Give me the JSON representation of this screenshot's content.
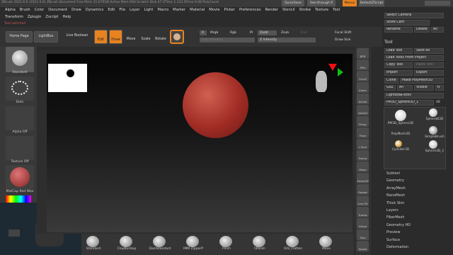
{
  "title": "ZBrush 2021.6.6 (2021.6.6) ZBrush Document",
  "title_stats": "Free Mem 31.679GB  Active Mem 694  Scratch Disk 47  ZTime 1.123 ATime 0.08  PolyCount",
  "quicksave": "QuickSave",
  "seethrough": "See-through 0",
  "menus_btn": "Menus",
  "defaultzscript": "DefaultZScript",
  "menus_row1": [
    "Alpha",
    "Brush",
    "Color",
    "Document",
    "Draw",
    "Dynamics",
    "Edit",
    "File",
    "Layer",
    "Light",
    "Macro",
    "Marker",
    "Material",
    "Movie",
    "Picker",
    "Preferences",
    "Render",
    "Stencil",
    "Stroke",
    "Texture",
    "Tool"
  ],
  "menus_row2": [
    "Transform",
    "Zplugin",
    "Zscript",
    "Help"
  ],
  "status": "Tool switched",
  "toolbar": {
    "home": "Home Page",
    "lightbox": "LightBox",
    "live_boolean": "Live Boolean",
    "edit": "Edit",
    "draw": "Draw",
    "move": "Move",
    "scale": "Scale",
    "rotate": "Rotate",
    "a": "A",
    "mrgb": "Mrgb",
    "rgb": "Rgb",
    "m": "M",
    "zadd": "Zadd",
    "zsub": "Zsub",
    "zcut": "Zcut",
    "rgb_intensity": "Rgb Intensity",
    "z_intensity": "Z Intensity",
    "focal_shift": "Focal Shift",
    "draw_size": "Draw Size"
  },
  "left_shelf": {
    "brush": "Standard",
    "stroke": "Dots",
    "alpha": "Alpha Off",
    "texture": "Texture Off",
    "material": "MatCap Red Wax"
  },
  "bottom_shelf": [
    "Standard",
    "ClayBuildup",
    "DamStandard",
    "IMM ZipperP",
    "Pinch",
    "hPolish",
    "Orb_Flatten",
    "Move"
  ],
  "right_shelf": [
    "BPR",
    "SPix",
    "Scroll",
    "Zoom",
    "Actual",
    "AAHalf",
    "Persp",
    "Floor",
    "L.Sym",
    "Frame",
    "Move",
    "Zoom3D",
    "Rotate",
    "Line Fill",
    "Transp",
    "Ghost",
    "Solo",
    "Xpose"
  ],
  "panel": {
    "select_camera": "Select Camera",
    "store_cam": "Store Cam",
    "rename": "Rename",
    "delete": "Delete",
    "all": "All",
    "tool_header": "Tool",
    "load_tool": "Load Tool",
    "save_as": "Save As",
    "load_project": "Load Tools From Project",
    "copy_tool": "Copy Tool",
    "paste_tool": "Paste Tool",
    "import": "Import",
    "export": "Export",
    "clone": "Clone",
    "make_polymesh": "Make PolyMesh3D",
    "goz": "GoZ",
    "all2": "All",
    "visible": "Visible",
    "r": "R",
    "lightbox_tools": "Lightbox▸Tools",
    "current_tool": "PM3D_Sphere3D_1",
    "tool_number": "48",
    "tools": [
      "PM3D_Sphere3D",
      "SphereB3D",
      "PolyMesh3D",
      "SimpleBrush",
      "Cylinder3D",
      "Sphere3D_1",
      "PM3D_Sphere3D_1"
    ],
    "subpalettes": [
      "Subtool",
      "Geometry",
      "ArrayMesh",
      "NanoMesh",
      "Thick Skin",
      "Layers",
      "FiberMesh",
      "Geometry HD",
      "Preview",
      "Surface",
      "Deformation"
    ]
  },
  "colors": {
    "accent": "#e8831f",
    "sphere": "#b0302a"
  }
}
